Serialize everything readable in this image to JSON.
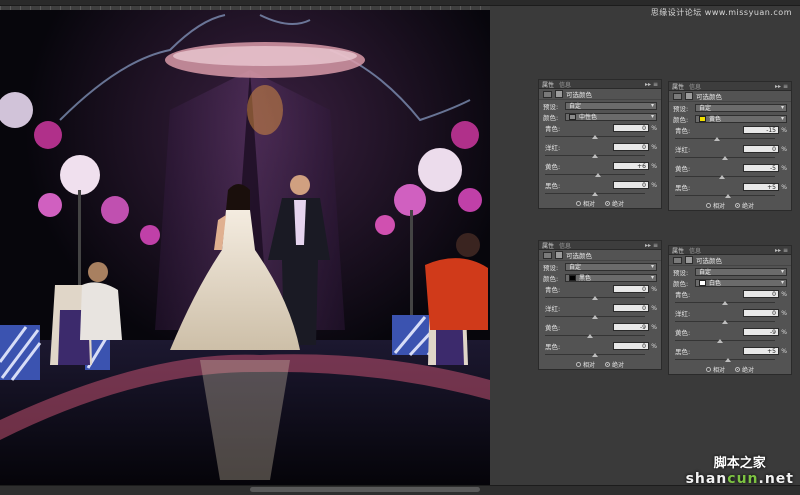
{
  "watermark_top": "思缘设计论坛 www.missyuan.com",
  "watermark_bottom": {
    "line1": "脚本之家",
    "line2_a": "shan",
    "line2_b": "cun",
    "line2_c": ".net"
  },
  "panels": [
    {
      "tab1": "属性",
      "tab2": "信息",
      "title": "可选颜色",
      "preset_label": "预设:",
      "preset": "自定",
      "color_label": "颜色:",
      "color": "中性色",
      "swatch": "#8a8a8a",
      "sliders": [
        {
          "label": "青色:",
          "value": "0",
          "pos": 50
        },
        {
          "label": "洋红:",
          "value": "0",
          "pos": 50
        },
        {
          "label": "黄色:",
          "value": "+6",
          "pos": 53
        },
        {
          "label": "黑色:",
          "value": "0",
          "pos": 50
        }
      ],
      "rel": "相对",
      "abs": "绝对",
      "mode": "abs"
    },
    {
      "tab1": "属性",
      "tab2": "信息",
      "title": "可选颜色",
      "preset_label": "预设:",
      "preset": "自定",
      "color_label": "颜色:",
      "color": "黄色",
      "swatch": "#f0e000",
      "sliders": [
        {
          "label": "青色:",
          "value": "-15",
          "pos": 42
        },
        {
          "label": "洋红:",
          "value": "0",
          "pos": 50
        },
        {
          "label": "黄色:",
          "value": "-5",
          "pos": 47
        },
        {
          "label": "黑色:",
          "value": "+5",
          "pos": 53
        }
      ],
      "rel": "相对",
      "abs": "绝对",
      "mode": "abs"
    },
    {
      "tab1": "属性",
      "tab2": "信息",
      "title": "可选颜色",
      "preset_label": "预设:",
      "preset": "自定",
      "color_label": "颜色:",
      "color": "黑色",
      "swatch": "#000000",
      "sliders": [
        {
          "label": "青色:",
          "value": "0",
          "pos": 50
        },
        {
          "label": "洋红:",
          "value": "0",
          "pos": 50
        },
        {
          "label": "黄色:",
          "value": "-9",
          "pos": 45
        },
        {
          "label": "黑色:",
          "value": "0",
          "pos": 50
        }
      ],
      "rel": "相对",
      "abs": "绝对",
      "mode": "abs"
    },
    {
      "tab1": "属性",
      "tab2": "信息",
      "title": "可选颜色",
      "preset_label": "预设:",
      "preset": "自定",
      "color_label": "颜色:",
      "color": "白色",
      "swatch": "#ffffff",
      "sliders": [
        {
          "label": "青色:",
          "value": "0",
          "pos": 50
        },
        {
          "label": "洋红:",
          "value": "0",
          "pos": 50
        },
        {
          "label": "黄色:",
          "value": "-9",
          "pos": 45
        },
        {
          "label": "黑色:",
          "value": "+5",
          "pos": 53
        }
      ],
      "rel": "相对",
      "abs": "绝对",
      "mode": "abs"
    }
  ]
}
